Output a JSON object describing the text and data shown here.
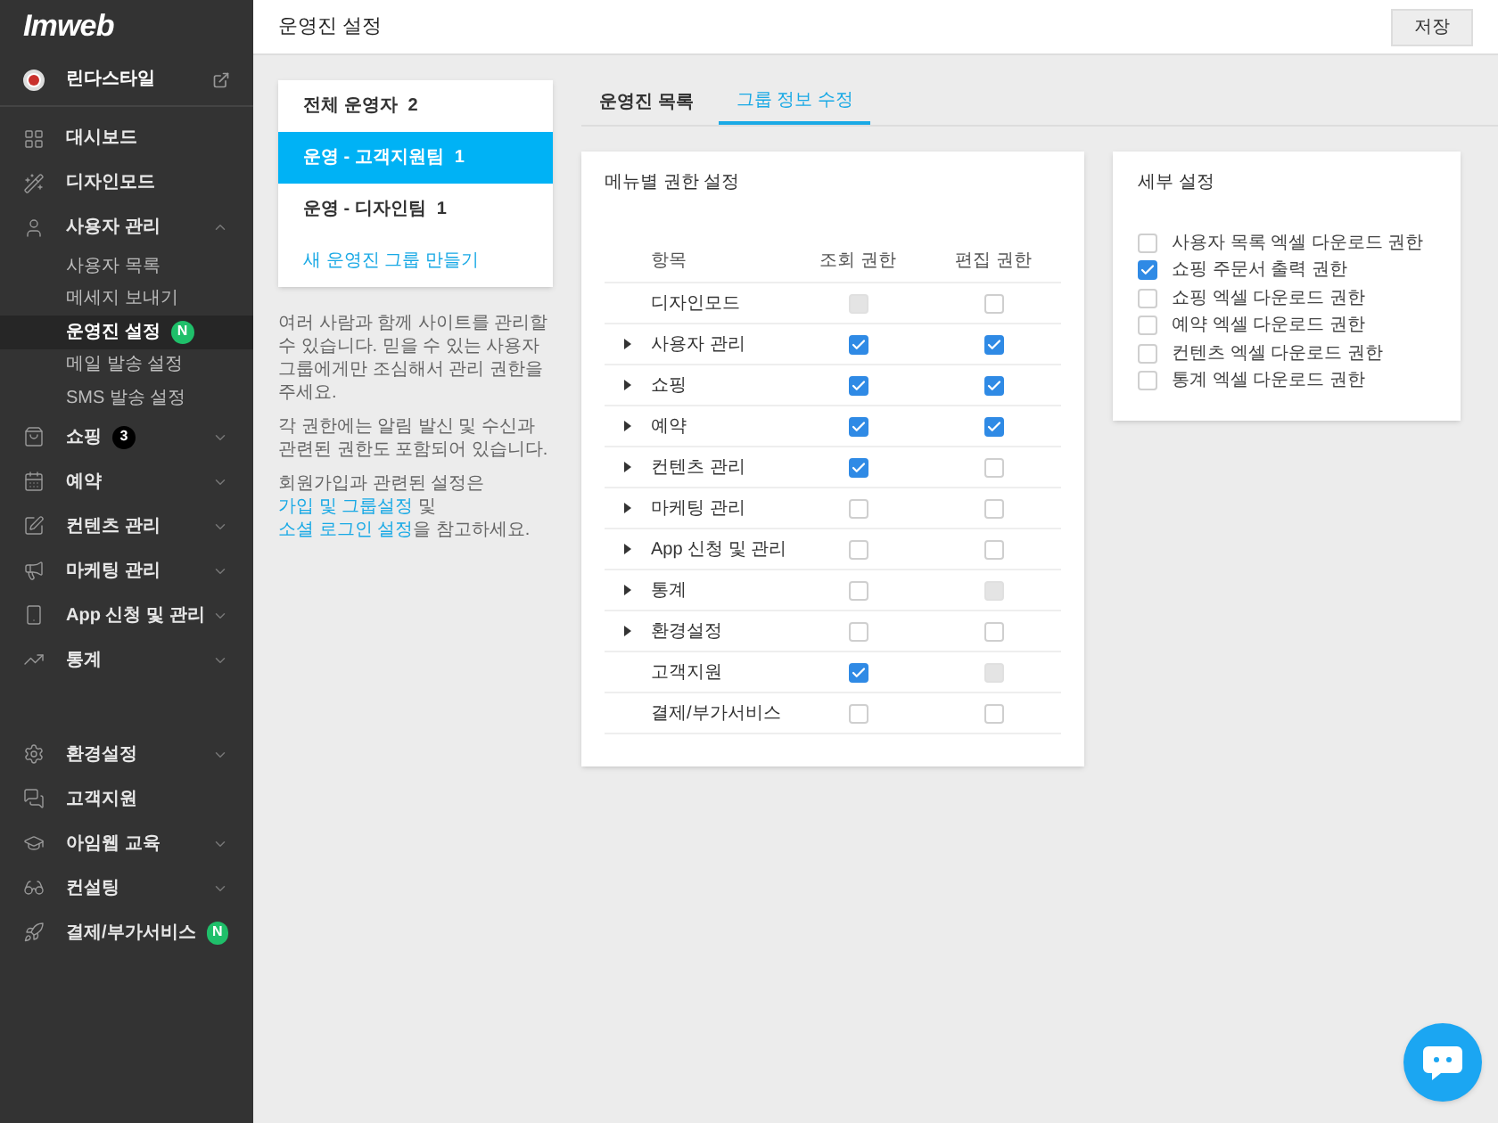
{
  "logo": "Imweb",
  "site": {
    "name": "린다스타일"
  },
  "sidebar": {
    "top": [
      {
        "label": "대시보드",
        "expandable": false
      },
      {
        "label": "디자인모드",
        "expandable": false
      },
      {
        "label": "사용자 관리",
        "expandable": true,
        "expanded": true,
        "children": [
          {
            "label": "사용자 목록",
            "selected": false
          },
          {
            "label": "메세지 보내기",
            "selected": false
          },
          {
            "label": "운영진 설정",
            "selected": true,
            "badge": {
              "text": "N",
              "kind": "new"
            }
          },
          {
            "label": "메일 발송 설정",
            "selected": false
          },
          {
            "label": "SMS 발송 설정",
            "selected": false
          }
        ]
      },
      {
        "label": "쇼핑",
        "expandable": true,
        "expanded": false,
        "badge": {
          "text": "3",
          "kind": "count"
        }
      },
      {
        "label": "예약",
        "expandable": true,
        "expanded": false
      },
      {
        "label": "컨텐츠 관리",
        "expandable": true,
        "expanded": false
      },
      {
        "label": "마케팅 관리",
        "expandable": true,
        "expanded": false
      },
      {
        "label": "App 신청 및 관리",
        "expandable": true,
        "expanded": false
      },
      {
        "label": "통계",
        "expandable": true,
        "expanded": false
      }
    ],
    "bottom": [
      {
        "label": "환경설정",
        "expandable": true,
        "expanded": false
      },
      {
        "label": "고객지원",
        "expandable": false
      },
      {
        "label": "아임웹 교육",
        "expandable": true,
        "expanded": false
      },
      {
        "label": "컨설팅",
        "expandable": true,
        "expanded": false
      },
      {
        "label": "결제/부가서비스",
        "expandable": false,
        "badge": {
          "text": "N",
          "kind": "new"
        }
      }
    ]
  },
  "header": {
    "title": "운영진 설정",
    "save_button": "저장"
  },
  "groups": {
    "items": [
      {
        "label": "전체 운영자",
        "count": "2",
        "selected": false
      },
      {
        "label": "운영 - 고객지원팀",
        "count": "1",
        "selected": true
      },
      {
        "label": "운영 - 디자인팀",
        "count": "1",
        "selected": false
      }
    ],
    "new_group_link": "새 운영진 그룹 만들기"
  },
  "help": [
    "여러 사람과 함께 사이트를 관리할 수 있습니다. 믿을 수 있는 사용자 그룹에게만 조심해서 관리 권한을 주세요.",
    "각 권한에는 알림 발신 및 수신과 관련된 권한도 포함되어 있습니다.",
    [
      {
        "text": "회원가입과 관련된 설정은 ",
        "kind": "text"
      },
      {
        "text": "가입 및 그룹설정",
        "kind": "link"
      },
      {
        "text": " 및 ",
        "kind": "text"
      },
      {
        "text": "소셜 로그인 설정",
        "kind": "link"
      },
      {
        "text": "을 참고하세요.",
        "kind": "text"
      }
    ]
  ],
  "tabs": [
    {
      "label": "운영진 목록",
      "selected": false
    },
    {
      "label": "그룹 정보 수정",
      "selected": true
    }
  ],
  "permissions": {
    "title": "메뉴별 권한 설정",
    "columns": [
      "항목",
      "조회 권한",
      "편집 권한"
    ],
    "rows": [
      {
        "label": "디자인모드",
        "expandable": false,
        "view": {
          "checked": false,
          "disabled": true
        },
        "edit": {
          "checked": false,
          "disabled": false
        }
      },
      {
        "label": "사용자 관리",
        "expandable": true,
        "view": {
          "checked": true,
          "disabled": false
        },
        "edit": {
          "checked": true,
          "disabled": false
        }
      },
      {
        "label": "쇼핑",
        "expandable": true,
        "view": {
          "checked": true,
          "disabled": false
        },
        "edit": {
          "checked": true,
          "disabled": false
        }
      },
      {
        "label": "예약",
        "expandable": true,
        "view": {
          "checked": true,
          "disabled": false
        },
        "edit": {
          "checked": true,
          "disabled": false
        }
      },
      {
        "label": "컨텐츠 관리",
        "expandable": true,
        "view": {
          "checked": true,
          "disabled": false
        },
        "edit": {
          "checked": false,
          "disabled": false
        }
      },
      {
        "label": "마케팅 관리",
        "expandable": true,
        "view": {
          "checked": false,
          "disabled": false
        },
        "edit": {
          "checked": false,
          "disabled": false
        }
      },
      {
        "label": "App 신청 및 관리",
        "expandable": true,
        "view": {
          "checked": false,
          "disabled": false
        },
        "edit": {
          "checked": false,
          "disabled": false
        }
      },
      {
        "label": "통계",
        "expandable": true,
        "view": {
          "checked": false,
          "disabled": false
        },
        "edit": {
          "checked": false,
          "disabled": true
        }
      },
      {
        "label": "환경설정",
        "expandable": true,
        "view": {
          "checked": false,
          "disabled": false
        },
        "edit": {
          "checked": false,
          "disabled": false
        }
      },
      {
        "label": "고객지원",
        "expandable": false,
        "view": {
          "checked": true,
          "disabled": false
        },
        "edit": {
          "checked": false,
          "disabled": true
        }
      },
      {
        "label": "결제/부가서비스",
        "expandable": false,
        "view": {
          "checked": false,
          "disabled": false
        },
        "edit": {
          "checked": false,
          "disabled": false
        }
      }
    ]
  },
  "details": {
    "title": "세부 설정",
    "options": [
      {
        "label": "사용자 목록 엑셀 다운로드 권한",
        "checked": false
      },
      {
        "label": "쇼핑 주문서 출력 권한",
        "checked": true
      },
      {
        "label": "쇼핑 엑셀 다운로드 권한",
        "checked": false
      },
      {
        "label": "예약 엑셀 다운로드 권한",
        "checked": false
      },
      {
        "label": "컨텐츠 엑셀 다운로드 권한",
        "checked": false
      },
      {
        "label": "통계 엑셀 다운로드 권한",
        "checked": false
      }
    ]
  }
}
